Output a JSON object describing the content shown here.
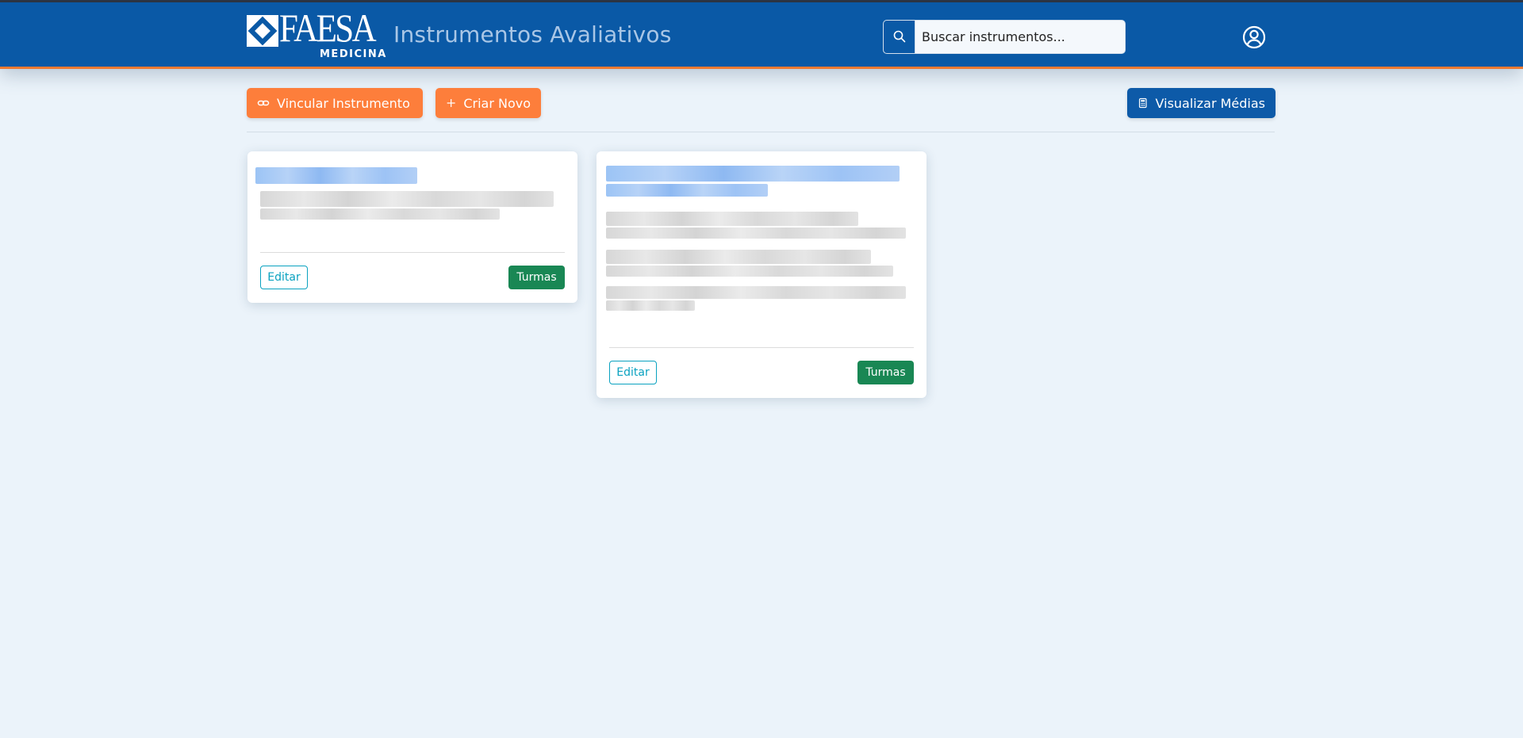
{
  "brand": {
    "logo_text": "FAESA",
    "logo_subtext": "MEDICINA",
    "app_title": "Instrumentos Avaliativos"
  },
  "search": {
    "placeholder": "Buscar instrumentos...",
    "value": ""
  },
  "toolbar": {
    "link_label": "Vincular Instrumento",
    "create_label": "Criar Novo",
    "averages_label": "Visualizar Médias"
  },
  "cards": [
    {
      "edit_label": "Editar",
      "classes_label": "Turmas"
    },
    {
      "edit_label": "Editar",
      "classes_label": "Turmas"
    }
  ],
  "colors": {
    "header": "#0a59a6",
    "header_accent": "#f07a32",
    "primary_orange": "#fd7e3b",
    "primary_blue": "#0d5aa8",
    "edit_outline": "#0aa2c0",
    "turmas_green": "#198754",
    "page_background": "#ebf3fa"
  },
  "icons": {
    "search": "search-icon",
    "user": "user-circle-icon",
    "link": "link-icon",
    "plus": "plus-icon",
    "calculator": "calculator-icon"
  }
}
